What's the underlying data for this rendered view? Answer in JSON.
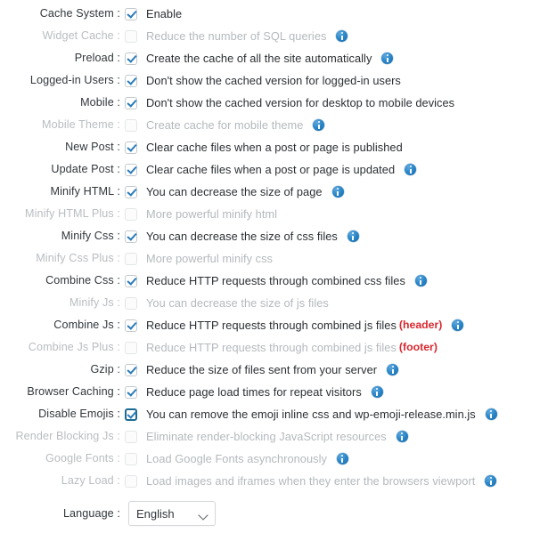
{
  "form": {
    "label_suffix": " :",
    "rows": [
      {
        "label": "Cache System",
        "text": "Enable",
        "checked": true,
        "disabled": false,
        "info": false,
        "tag": "",
        "focused": false
      },
      {
        "label": "Widget Cache",
        "text": "Reduce the number of SQL queries",
        "checked": false,
        "disabled": true,
        "info": true,
        "tag": "",
        "focused": false
      },
      {
        "label": "Preload",
        "text": "Create the cache of all the site automatically",
        "checked": true,
        "disabled": false,
        "info": true,
        "tag": "",
        "focused": false
      },
      {
        "label": "Logged-in Users",
        "text": "Don't show the cached version for logged-in users",
        "checked": true,
        "disabled": false,
        "info": false,
        "tag": "",
        "focused": false
      },
      {
        "label": "Mobile",
        "text": "Don't show the cached version for desktop to mobile devices",
        "checked": true,
        "disabled": false,
        "info": false,
        "tag": "",
        "focused": false
      },
      {
        "label": "Mobile Theme",
        "text": "Create cache for mobile theme",
        "checked": false,
        "disabled": true,
        "info": true,
        "tag": "",
        "focused": false
      },
      {
        "label": "New Post",
        "text": "Clear cache files when a post or page is published",
        "checked": true,
        "disabled": false,
        "info": false,
        "tag": "",
        "focused": false
      },
      {
        "label": "Update Post",
        "text": "Clear cache files when a post or page is updated",
        "checked": true,
        "disabled": false,
        "info": true,
        "tag": "",
        "focused": false
      },
      {
        "label": "Minify HTML",
        "text": "You can decrease the size of page",
        "checked": true,
        "disabled": false,
        "info": true,
        "tag": "",
        "focused": false
      },
      {
        "label": "Minify HTML Plus",
        "text": "More powerful minify html",
        "checked": false,
        "disabled": true,
        "info": false,
        "tag": "",
        "focused": false
      },
      {
        "label": "Minify Css",
        "text": "You can decrease the size of css files",
        "checked": true,
        "disabled": false,
        "info": true,
        "tag": "",
        "focused": false
      },
      {
        "label": "Minify Css Plus",
        "text": "More powerful minify css",
        "checked": false,
        "disabled": true,
        "info": false,
        "tag": "",
        "focused": false
      },
      {
        "label": "Combine Css",
        "text": "Reduce HTTP requests through combined css files",
        "checked": true,
        "disabled": false,
        "info": true,
        "tag": "",
        "focused": false
      },
      {
        "label": "Minify Js",
        "text": "You can decrease the size of js files",
        "checked": false,
        "disabled": true,
        "info": false,
        "tag": "",
        "focused": false
      },
      {
        "label": "Combine Js",
        "text": "Reduce HTTP requests through combined js files",
        "checked": true,
        "disabled": false,
        "info": true,
        "tag": "(header)",
        "focused": false
      },
      {
        "label": "Combine Js Plus",
        "text": "Reduce HTTP requests through combined js files",
        "checked": false,
        "disabled": true,
        "info": false,
        "tag": "(footer)",
        "focused": false
      },
      {
        "label": "Gzip",
        "text": "Reduce the size of files sent from your server",
        "checked": true,
        "disabled": false,
        "info": true,
        "tag": "",
        "focused": false
      },
      {
        "label": "Browser Caching",
        "text": "Reduce page load times for repeat visitors",
        "checked": true,
        "disabled": false,
        "info": true,
        "tag": "",
        "focused": false
      },
      {
        "label": "Disable Emojis",
        "text": "You can remove the emoji inline css and wp-emoji-release.min.js",
        "checked": true,
        "disabled": false,
        "info": true,
        "tag": "",
        "focused": true
      },
      {
        "label": "Render Blocking Js",
        "text": "Eliminate render-blocking JavaScript resources",
        "checked": false,
        "disabled": true,
        "info": true,
        "tag": "",
        "focused": false
      },
      {
        "label": "Google Fonts",
        "text": "Load Google Fonts asynchronously",
        "checked": false,
        "disabled": true,
        "info": true,
        "tag": "",
        "focused": false
      },
      {
        "label": "Lazy Load",
        "text": "Load images and iframes when they enter the browsers viewport",
        "checked": false,
        "disabled": true,
        "info": true,
        "tag": "",
        "focused": false
      }
    ],
    "language": {
      "label": "Language",
      "value": "English",
      "options": [
        "English"
      ],
      "caret_icon": "chevron-down-icon"
    }
  },
  "colors": {
    "checkmark": "#2a7bb9",
    "info_icon": "#2a86c8",
    "tag_red": "#d9282f",
    "label": "#32373c",
    "label_disabled": "#b9bdc1",
    "text": "#2b2f33",
    "text_disabled": "#b4b9bd",
    "focus_border": "#1c6b93",
    "background": "#ffffff"
  }
}
